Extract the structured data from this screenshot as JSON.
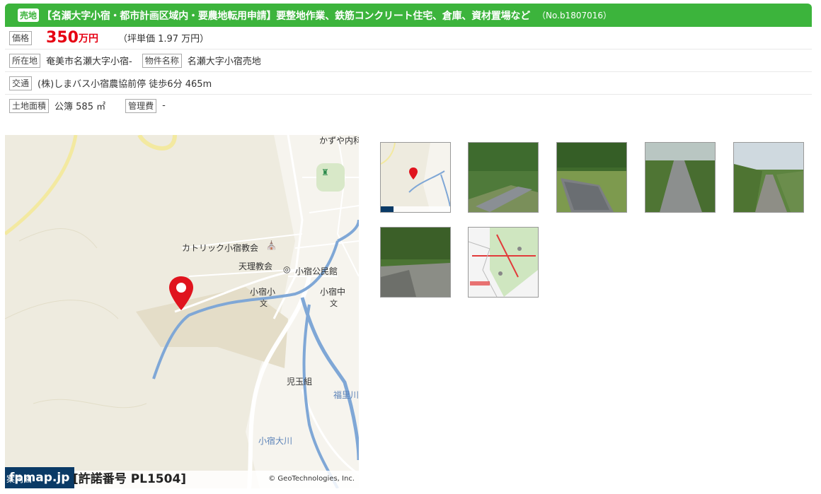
{
  "header": {
    "badge": "売地",
    "title": "【名瀬大字小宿・都市計画区域内・要農地転用申請】要整地作業、鉄筋コンクリート住宅、倉庫、資材置場など",
    "property_no": "（No.b1807016）"
  },
  "price": {
    "label": "価格",
    "amount": "350",
    "unit": "万円",
    "tsubo": "（坪単価 1.97 万円）"
  },
  "location": {
    "label": "所在地",
    "value": "奄美市名瀬大字小宿-",
    "name_label": "物件名称",
    "name_value": "名瀬大字小宿売地"
  },
  "transport": {
    "label": "交通",
    "value": "(株)しまバス小宿農協前停  徒歩6分 465m"
  },
  "land": {
    "area_label": "土地面積",
    "area_value": "公簿 585 ㎡",
    "fee_label": "管理費",
    "fee_value": "-"
  },
  "map": {
    "labels": {
      "kazuya": "かずや内科",
      "church": "カトリック小宿教会",
      "tenri": "天理教会",
      "kominkan": "小宿公民館",
      "elementary": "小宿小",
      "junior": "小宿中",
      "kodama": "児玉組",
      "fukusato": "福里川",
      "oko": "小宿大川"
    },
    "footer": {
      "annai": "案内図",
      "logo": "fpmap.jp",
      "license": "[許諾番号 PL1504]",
      "copyright": "© GeoTechnologies, Inc."
    }
  },
  "colors": {
    "header_green": "#3cb43c",
    "price_red": "#e60012",
    "pin_red": "#e0141e",
    "river": "#7fa7d6",
    "road_yellow": "#f3e9a0"
  }
}
